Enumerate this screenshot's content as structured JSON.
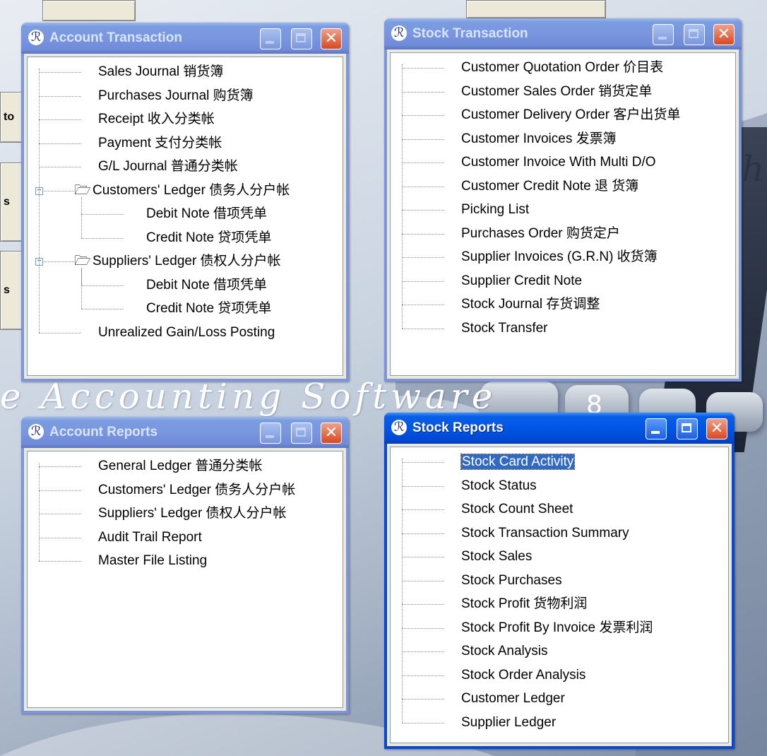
{
  "background": {
    "tagline": "e Accounting Software",
    "partial_letter": "h",
    "left_buttons": [
      "to",
      "s",
      "s"
    ],
    "keypad_digit": "8"
  },
  "windows": {
    "account_transaction": {
      "title": "Account Transaction",
      "items": [
        {
          "label": "Sales Journal 销货簿"
        },
        {
          "label": "Purchases Journal 购货簿"
        },
        {
          "label": "Receipt  收入分类帐"
        },
        {
          "label": "Payment 支付分类帐"
        },
        {
          "label": "G/L Journal 普通分类帐"
        },
        {
          "label": "Customers' Ledger 债务人分户帐",
          "folder": true
        },
        {
          "label": "Debit Note 借项凭单",
          "child": true
        },
        {
          "label": "Credit Note 贷项凭单",
          "child": true
        },
        {
          "label": "Suppliers' Ledger 债权人分户帐",
          "folder": true
        },
        {
          "label": "Debit Note 借项凭单",
          "child": true
        },
        {
          "label": "Credit Note 贷项凭单",
          "child": true
        },
        {
          "label": "Unrealized Gain/Loss Posting"
        }
      ]
    },
    "stock_transaction": {
      "title": "Stock Transaction",
      "items": [
        {
          "label": "Customer Quotation Order 价目表"
        },
        {
          "label": "Customer Sales Order 销货定单"
        },
        {
          "label": "Customer Delivery Order 客户出货单"
        },
        {
          "label": "Customer Invoices 发票簿"
        },
        {
          "label": "Customer Invoice With Multi D/O"
        },
        {
          "label": "Customer Credit Note 退 货簿"
        },
        {
          "label": "Picking List"
        },
        {
          "label": "Purchases Order 购货定户"
        },
        {
          "label": "Supplier Invoices (G.R.N) 收货簿"
        },
        {
          "label": "Supplier Credit Note"
        },
        {
          "label": "Stock Journal 存货调整"
        },
        {
          "label": "Stock Transfer"
        }
      ]
    },
    "account_reports": {
      "title": "Account Reports",
      "items": [
        {
          "label": "General Ledger 普通分类帐"
        },
        {
          "label": "Customers' Ledger 债务人分户帐"
        },
        {
          "label": "Suppliers' Ledger 债权人分户帐"
        },
        {
          "label": "Audit Trail Report"
        },
        {
          "label": "Master File Listing"
        }
      ]
    },
    "stock_reports": {
      "title": "Stock Reports",
      "selected_index": 0,
      "items": [
        {
          "label": "Stock Card Activity"
        },
        {
          "label": "Stock Status"
        },
        {
          "label": "Stock Count Sheet"
        },
        {
          "label": "Stock Transaction Summary"
        },
        {
          "label": "Stock Sales"
        },
        {
          "label": "Stock Purchases"
        },
        {
          "label": "Stock Profit 货物利润"
        },
        {
          "label": "Stock Profit By Invoice 发票利润"
        },
        {
          "label": "Stock Analysis"
        },
        {
          "label": "Stock Order Analysis"
        },
        {
          "label": "Customer Ledger"
        },
        {
          "label": "Supplier Ledger"
        }
      ]
    }
  },
  "icons": {
    "title_icon": "app-logo-icon",
    "minimize": "minimize-icon",
    "maximize": "maximize-icon",
    "close": "close-icon",
    "folder": "folder-open-icon"
  },
  "colors": {
    "active_title": "#0055e5",
    "inactive_title": "#7a96df",
    "selection": "#316ac5",
    "close_button": "#d9481f"
  }
}
